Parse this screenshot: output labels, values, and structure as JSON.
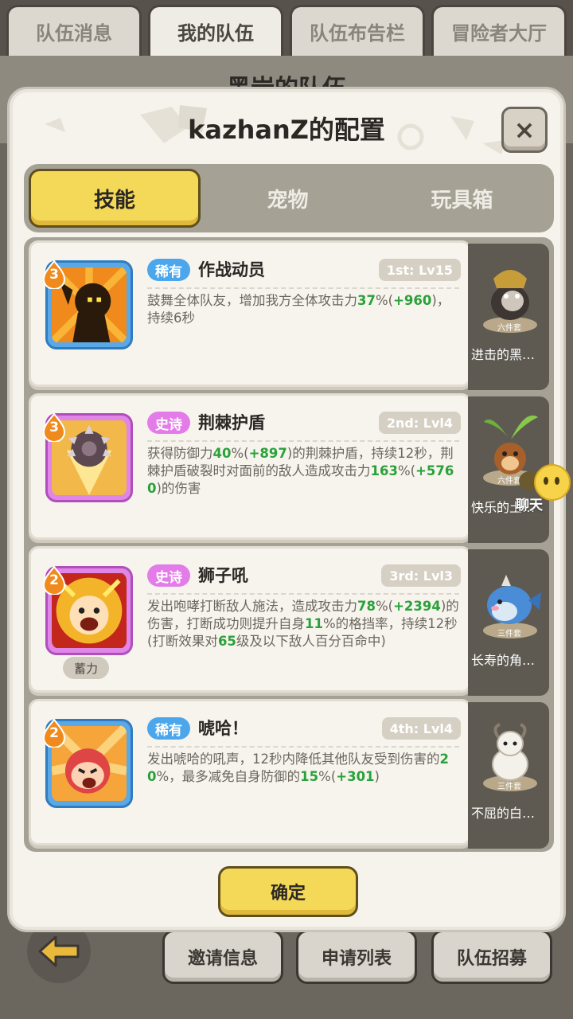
{
  "top_tabs": [
    "队伍消息",
    "我的队伍",
    "队伍布告栏",
    "冒险者大厅"
  ],
  "background_title": "黑岩的队伍",
  "dialog": {
    "title": "kazhanZ的配置",
    "close_icon": "×",
    "tabs": [
      "技能",
      "宠物",
      "玩具箱"
    ],
    "active_tab": "技能",
    "confirm_label": "确定"
  },
  "skills": [
    {
      "level": "3",
      "rarity": "稀有",
      "rarity_type": "rare",
      "name": "作战动员",
      "rank": "1st: Lv15",
      "icon": "rally-shout-icon",
      "desc": [
        {
          "t": "鼓舞全体队友，增加我方全体攻击力"
        },
        {
          "t": "37",
          "g": true
        },
        {
          "t": "%("
        },
        {
          "t": "+960",
          "g": true
        },
        {
          "t": ")，持续6秒"
        }
      ]
    },
    {
      "level": "3",
      "rarity": "史诗",
      "rarity_type": "epic",
      "name": "荆棘护盾",
      "rank": "2nd: Lvl4",
      "icon": "thorn-shield-icon",
      "desc": [
        {
          "t": "获得防御力"
        },
        {
          "t": "40",
          "g": true
        },
        {
          "t": "%("
        },
        {
          "t": "+897",
          "g": true
        },
        {
          "t": ")的荆棘护盾，持续12秒，荆棘护盾破裂时对面前的敌人造成攻击力"
        },
        {
          "t": "163",
          "g": true
        },
        {
          "t": "%("
        },
        {
          "t": "+5760",
          "g": true
        },
        {
          "t": ")的伤害"
        }
      ]
    },
    {
      "level": "2",
      "rarity": "史诗",
      "rarity_type": "epic",
      "name": "狮子吼",
      "rank": "3rd: Lvl3",
      "icon": "lion-roar-icon",
      "tag": "蓄力",
      "desc": [
        {
          "t": "发出咆哮打断敌人施法，造成攻击力"
        },
        {
          "t": "78",
          "g": true
        },
        {
          "t": "%("
        },
        {
          "t": "+2394",
          "g": true
        },
        {
          "t": ")的伤害，打断成功则提升自身"
        },
        {
          "t": "11",
          "g": true
        },
        {
          "t": "%的格挡率，持续12秒(打断效果对"
        },
        {
          "t": "65",
          "g": true
        },
        {
          "t": "级及以下敌人百分百命中)"
        }
      ]
    },
    {
      "level": "2",
      "rarity": "稀有",
      "rarity_type": "rare",
      "name": "唬哈！",
      "rank": "4th: Lvl4",
      "icon": "war-cry-icon",
      "desc": [
        {
          "t": "发出唬哈的吼声，12秒内降低其他队友受到伤害的"
        },
        {
          "t": "20",
          "g": true
        },
        {
          "t": "%，最多减免自身防御的"
        },
        {
          "t": "15",
          "g": true
        },
        {
          "t": "%("
        },
        {
          "t": "+301",
          "g": true
        },
        {
          "t": ")"
        }
      ]
    }
  ],
  "pets": [
    {
      "name": "进击的黑…",
      "set": "六件套",
      "icon": "armored-mole-pet-icon"
    },
    {
      "name": "快乐的土…",
      "set": "六件套",
      "icon": "sprout-pet-icon"
    },
    {
      "name": "长寿的角…",
      "set": "三件套",
      "icon": "whale-pet-icon"
    },
    {
      "name": "不屈的白…",
      "set": "三件套",
      "icon": "goat-pet-icon"
    }
  ],
  "chat_label": "聊天",
  "bottom_buttons": [
    "邀请信息",
    "申请列表",
    "队伍招募"
  ]
}
